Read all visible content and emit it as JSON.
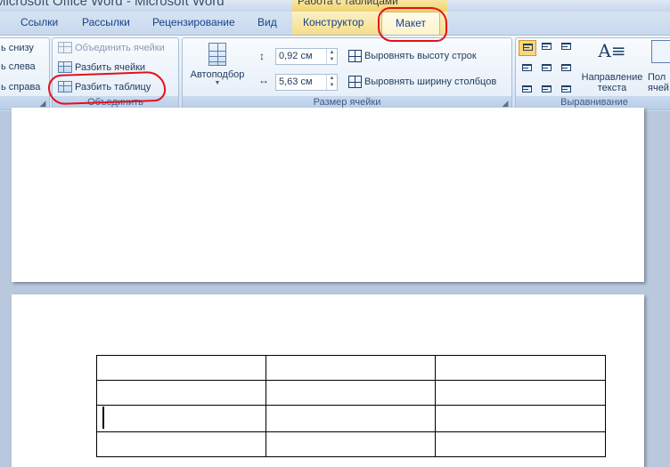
{
  "window": {
    "title": "Microsoft Office Word - Microsoft Word",
    "context_title": "Работа с таблицами"
  },
  "tabs": [
    {
      "label": "Ссылки"
    },
    {
      "label": "Рассылки"
    },
    {
      "label": "Рецензирование"
    },
    {
      "label": "Вид"
    },
    {
      "label": "Конструктор"
    },
    {
      "label": "Макет",
      "active": true
    }
  ],
  "ribbon": {
    "rows_columns": {
      "insert_below": "ь снизу",
      "insert_left": "ь слева",
      "insert_right": "ь справа"
    },
    "merge": {
      "label": "Объединить",
      "merge_cells": "Объединить ячейки",
      "split_cells": "Разбить ячейки",
      "split_table": "Разбить таблицу"
    },
    "cell_size": {
      "label": "Размер ячейки",
      "autofit": "Автоподбор",
      "height_value": "0,92 см",
      "width_value": "5,63 см",
      "distribute_rows": "Выровнять высоту строк",
      "distribute_columns": "Выровнять ширину столбцов"
    },
    "alignment": {
      "label": "Выравнивание",
      "text_direction_line1": "Направление",
      "text_direction_line2": "текста",
      "cell_margins_line1": "Пол",
      "cell_margins_line2": "ячей"
    }
  },
  "document": {
    "table_rows": 4,
    "table_cols": 3,
    "cursor_cell": [
      2,
      0
    ]
  },
  "annotation_color": "#e3101c",
  "accent_colors": {
    "context_tab": "#f5dd8a",
    "selected_button": "#fbd67a"
  }
}
